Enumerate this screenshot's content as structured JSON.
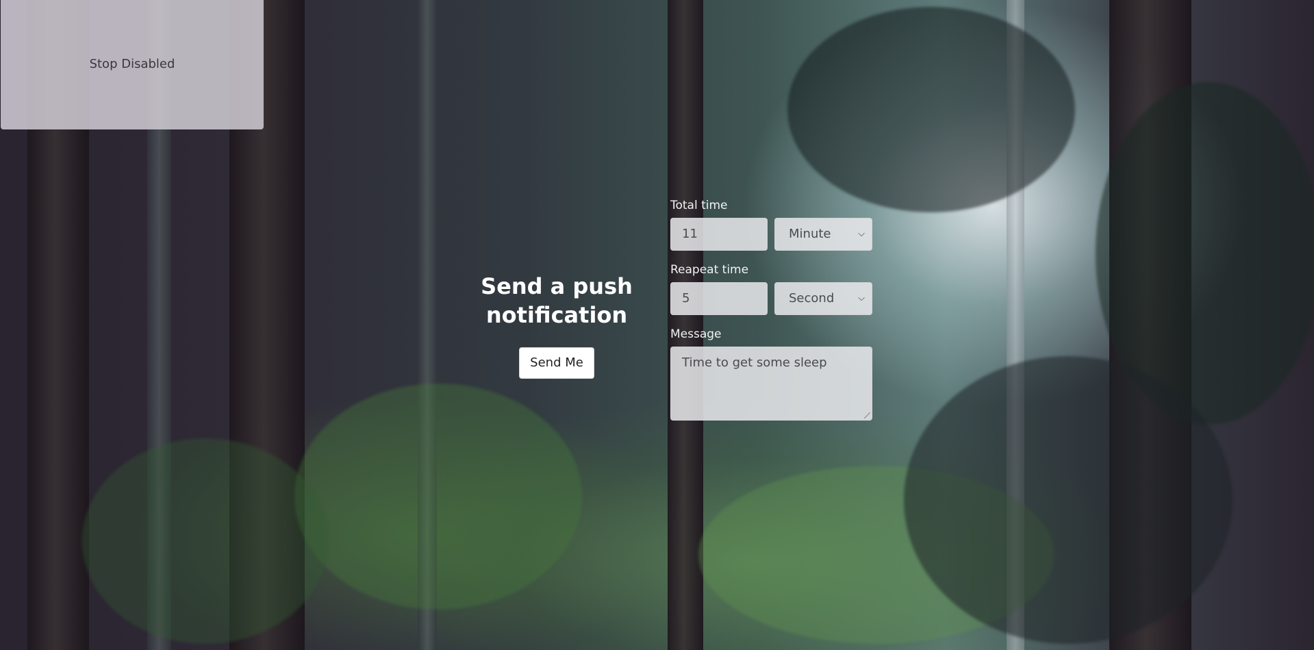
{
  "stop_panel": {
    "label": "Stop Disabled"
  },
  "hero": {
    "title": "Send a push notification",
    "button_label": "Send Me"
  },
  "form": {
    "total_time": {
      "label": "Total time",
      "value": "11",
      "unit": "Minute"
    },
    "repeat_time": {
      "label": "Reapeat time",
      "value": "5",
      "unit": "Second"
    },
    "message": {
      "label": "Message",
      "value": "Time to get some sleep"
    }
  },
  "icons": {
    "select_arrow": "chevron-down-icon",
    "resize": "resize-grip-icon"
  },
  "colors": {
    "panel": "#cdc8d0",
    "heading": "#ffffff",
    "button_bg": "#ffffff"
  }
}
